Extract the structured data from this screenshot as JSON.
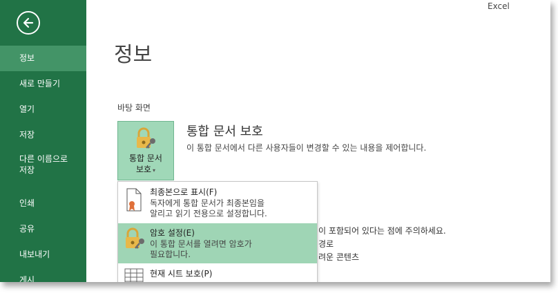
{
  "app": {
    "name": "Excel"
  },
  "sidebar": {
    "items": [
      {
        "label": "정보",
        "active": true
      },
      {
        "label": "새로 만들기"
      },
      {
        "label": "열기"
      },
      {
        "label": "저장"
      },
      {
        "label_line1": "다른 이름으로",
        "label_line2": "저장"
      },
      {
        "label": "인쇄"
      },
      {
        "label": "공유"
      },
      {
        "label": "내보내기"
      },
      {
        "label": "게시"
      }
    ]
  },
  "main": {
    "title": "정보",
    "location": "바탕 화면",
    "protect_button": {
      "line1": "통합 문서",
      "line2": "보호"
    },
    "protect_section": {
      "heading": "통합 문서 보호",
      "description": "이 통합 문서에서 다른 사용자들이 변경할 수 있는 내용을 제어합니다."
    },
    "background_text": {
      "line1": "이 포함되어 있다는 점에 주의하세요.",
      "line2": "경로",
      "line3": "려운 콘텐츠"
    }
  },
  "dropdown": {
    "items": [
      {
        "title": "최종본으로 표시(F)",
        "desc_line1": "독자에게 통합 문서가 최종본임을",
        "desc_line2": "알리고 읽기 전용으로 설정합니다.",
        "icon": "document-ribbon-icon"
      },
      {
        "title": "암호 설정(E)",
        "desc_line1": "이 통합 문서를 열려면 암호가",
        "desc_line2": "필요합니다.",
        "icon": "lock-key-icon",
        "highlighted": true
      },
      {
        "title": "현재 시트 보호(P)",
        "icon": "sheet-grid-icon"
      }
    ]
  },
  "colors": {
    "sidebar": "#217346",
    "sidebar_active": "#439467",
    "highlight": "#9fd5b5"
  }
}
